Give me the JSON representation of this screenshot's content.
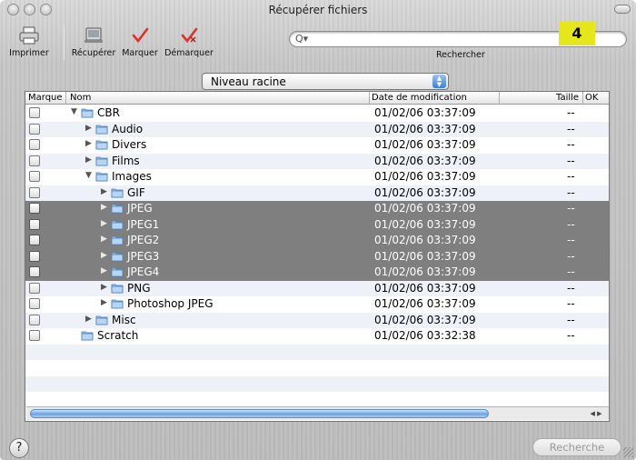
{
  "window": {
    "title": "Récupérer fichiers"
  },
  "toolbar": {
    "print_label": "Imprimer",
    "recover_label": "Récupérer",
    "mark_label": "Marquer",
    "unmark_label": "Démarquer",
    "search_label": "Rechercher",
    "search_placeholder": "",
    "step_badge": "4"
  },
  "location_popup": {
    "value": "Niveau racine"
  },
  "table": {
    "columns": {
      "mark": "Marque",
      "name": "Nom",
      "date": "Date de modification",
      "size": "Taille",
      "ok": "OK"
    },
    "rows": [
      {
        "name": "CBR",
        "date": "01/02/06 03:37:09",
        "size": "--",
        "level": 1,
        "expanded": true,
        "selected": false
      },
      {
        "name": "Audio",
        "date": "01/02/06 03:37:09",
        "size": "--",
        "level": 2,
        "expanded": false,
        "selected": false
      },
      {
        "name": "Divers",
        "date": "01/02/06 03:37:09",
        "size": "--",
        "level": 2,
        "expanded": false,
        "selected": false
      },
      {
        "name": "Films",
        "date": "01/02/06 03:37:09",
        "size": "--",
        "level": 2,
        "expanded": false,
        "selected": false
      },
      {
        "name": "Images",
        "date": "01/02/06 03:37:09",
        "size": "--",
        "level": 2,
        "expanded": true,
        "selected": false
      },
      {
        "name": "GIF",
        "date": "01/02/06 03:37:09",
        "size": "--",
        "level": 3,
        "expanded": false,
        "selected": false
      },
      {
        "name": "JPEG",
        "date": "01/02/06 03:37:09",
        "size": "--",
        "level": 3,
        "expanded": false,
        "selected": true
      },
      {
        "name": "JPEG1",
        "date": "01/02/06 03:37:09",
        "size": "--",
        "level": 3,
        "expanded": false,
        "selected": true
      },
      {
        "name": "JPEG2",
        "date": "01/02/06 03:37:09",
        "size": "--",
        "level": 3,
        "expanded": false,
        "selected": true
      },
      {
        "name": "JPEG3",
        "date": "01/02/06 03:37:09",
        "size": "--",
        "level": 3,
        "expanded": false,
        "selected": true
      },
      {
        "name": "JPEG4",
        "date": "01/02/06 03:37:09",
        "size": "--",
        "level": 3,
        "expanded": false,
        "selected": true
      },
      {
        "name": "PNG",
        "date": "01/02/06 03:37:09",
        "size": "--",
        "level": 3,
        "expanded": false,
        "selected": false
      },
      {
        "name": "Photoshop JPEG",
        "date": "01/02/06 03:37:09",
        "size": "--",
        "level": 3,
        "expanded": false,
        "selected": false
      },
      {
        "name": "Misc",
        "date": "01/02/06 03:37:09",
        "size": "--",
        "level": 2,
        "expanded": false,
        "selected": false
      },
      {
        "name": "Scratch",
        "date": "01/02/06 03:32:38",
        "size": "--",
        "level": 1,
        "expanded": null,
        "selected": false
      }
    ]
  },
  "footer": {
    "help_label": "?",
    "search_button": "Recherche"
  },
  "colors": {
    "selection": "#7f7f7f",
    "badge": "#e5e61c",
    "stripe": "#eef2f8",
    "mark_red": "#e0302a"
  }
}
